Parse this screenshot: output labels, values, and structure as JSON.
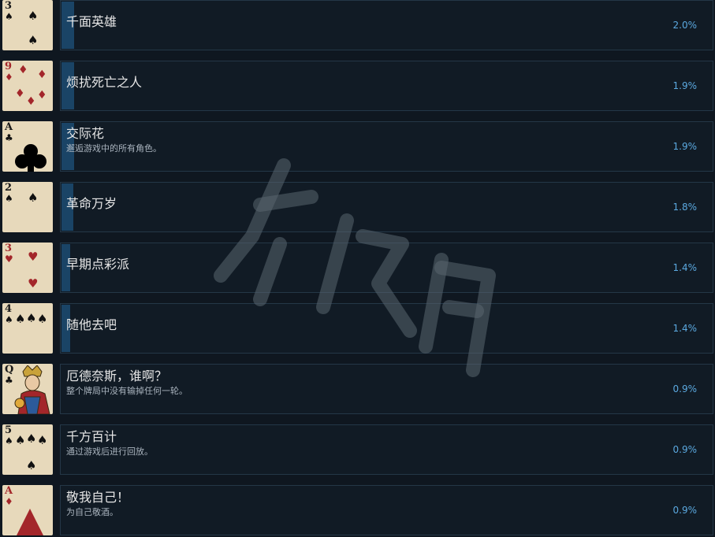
{
  "achievements": [
    {
      "card": {
        "rank": "3",
        "suit": "♠",
        "color": "black"
      },
      "title": "千面英雄",
      "desc": "",
      "pct": "2.0%",
      "progress": 2.0
    },
    {
      "card": {
        "rank": "9",
        "suit": "♦",
        "color": "red"
      },
      "title": "烦扰死亡之人",
      "desc": "",
      "pct": "1.9%",
      "progress": 1.9
    },
    {
      "card": {
        "rank": "A",
        "suit": "♣",
        "color": "black"
      },
      "title": "交际花",
      "desc": "邂逅游戏中的所有角色。",
      "pct": "1.9%",
      "progress": 1.9
    },
    {
      "card": {
        "rank": "2",
        "suit": "♠",
        "color": "black"
      },
      "title": "革命万岁",
      "desc": "",
      "pct": "1.8%",
      "progress": 1.8
    },
    {
      "card": {
        "rank": "3",
        "suit": "♥",
        "color": "red"
      },
      "title": "早期点彩派",
      "desc": "",
      "pct": "1.4%",
      "progress": 1.4
    },
    {
      "card": {
        "rank": "4",
        "suit": "♠",
        "color": "black"
      },
      "title": "随他去吧",
      "desc": "",
      "pct": "1.4%",
      "progress": 1.4
    },
    {
      "card": {
        "rank": "Q",
        "suit": "♣",
        "color": "black"
      },
      "title": "厄德奈斯，谁啊？",
      "desc": "整个牌局中没有输掉任何一轮。",
      "pct": "0.9%",
      "progress": 0.9
    },
    {
      "card": {
        "rank": "5",
        "suit": "♠",
        "color": "black"
      },
      "title": "千方百计",
      "desc": "通过游戏后进行回放。",
      "pct": "0.9%",
      "progress": 0.9
    },
    {
      "card": {
        "rank": "A",
        "suit": "♦",
        "color": "red"
      },
      "title": "敬我自己！",
      "desc": "为自己敬酒。",
      "pct": "0.9%",
      "progress": 0.9
    }
  ],
  "colors": {
    "background": "#0f1720",
    "panel": "#111b25",
    "panel_border": "#243747",
    "progress_bar": "#1a4466",
    "percent_text": "#5ba9e0",
    "card": "#e7d9bb",
    "red_suit": "#a3262a"
  }
}
